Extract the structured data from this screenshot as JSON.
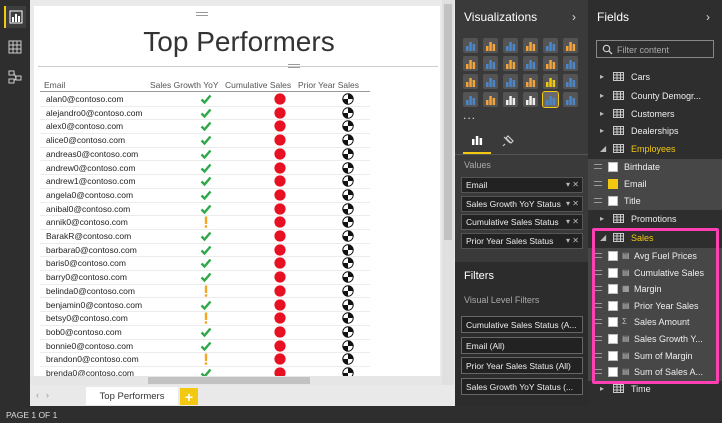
{
  "report": {
    "title": "Top Performers",
    "columns": [
      "Email",
      "Sales Growth YoY",
      "Cumulative Sales",
      "Prior Year Sales"
    ],
    "rows": [
      {
        "email": "alan0@contoso.com",
        "growth": "check"
      },
      {
        "email": "alejandro0@contoso.com",
        "growth": "check"
      },
      {
        "email": "alex0@contoso.com",
        "growth": "check"
      },
      {
        "email": "alice0@contoso.com",
        "growth": "check"
      },
      {
        "email": "andreas0@contoso.com",
        "growth": "check"
      },
      {
        "email": "andrew0@contoso.com",
        "growth": "check"
      },
      {
        "email": "andrew1@contoso.com",
        "growth": "check"
      },
      {
        "email": "angela0@contoso.com",
        "growth": "check"
      },
      {
        "email": "anibal0@contoso.com",
        "growth": "check"
      },
      {
        "email": "annik0@contoso.com",
        "growth": "exclaim"
      },
      {
        "email": "BarakR@contoso.com",
        "growth": "check"
      },
      {
        "email": "barbara0@contoso.com",
        "growth": "check"
      },
      {
        "email": "baris0@contoso.com",
        "growth": "check"
      },
      {
        "email": "barry0@contoso.com",
        "growth": "check"
      },
      {
        "email": "belinda0@contoso.com",
        "growth": "exclaim"
      },
      {
        "email": "benjamin0@contoso.com",
        "growth": "check"
      },
      {
        "email": "betsy0@contoso.com",
        "growth": "exclaim"
      },
      {
        "email": "bob0@contoso.com",
        "growth": "check"
      },
      {
        "email": "bonnie0@contoso.com",
        "growth": "check"
      },
      {
        "email": "brandon0@contoso.com",
        "growth": "exclaim"
      },
      {
        "email": "brenda0@contoso.com",
        "growth": "check"
      }
    ]
  },
  "page_tabs": {
    "active": "Top Performers",
    "add": "+"
  },
  "status": {
    "page_indicator": "PAGE 1 OF 1"
  },
  "visualizations": {
    "title": "Visualizations",
    "more": "...",
    "values_label": "Values",
    "wells": [
      "Email",
      "Sales Growth YoY Status",
      "Cumulative Sales Status",
      "Prior Year Sales Status"
    ],
    "filters_title": "Filters",
    "visual_level_filters_label": "Visual Level Filters",
    "filters": [
      "Cumulative Sales Status (A...",
      "Email (All)",
      "Prior Year Sales Status (All)",
      "Sales Growth YoY Status (..."
    ]
  },
  "fields": {
    "title": "Fields",
    "search_placeholder": "Filter content",
    "tables": [
      "Cars",
      "County Demogr...",
      "Customers",
      "Dealerships",
      "Employees"
    ],
    "employee_fields": [
      {
        "label": "Birthdate",
        "checked": false
      },
      {
        "label": "Email",
        "checked": true
      },
      {
        "label": "Title",
        "checked": false
      }
    ],
    "promotions": "Promotions",
    "sales": "Sales",
    "sales_fields": [
      "Avg Fuel Prices",
      "Cumulative Sales",
      "Margin",
      "Prior Year Sales",
      "Sales Amount",
      "Sales Growth Y...",
      "Sum of Margin",
      "Sum of Sales A..."
    ],
    "time": "Time"
  },
  "colors": {
    "accent": "#f2c811",
    "highlight": "#ff3fb4",
    "check_green": "#2ea84a",
    "exclaim_orange": "#f5a623",
    "red_status": "#e81123"
  }
}
